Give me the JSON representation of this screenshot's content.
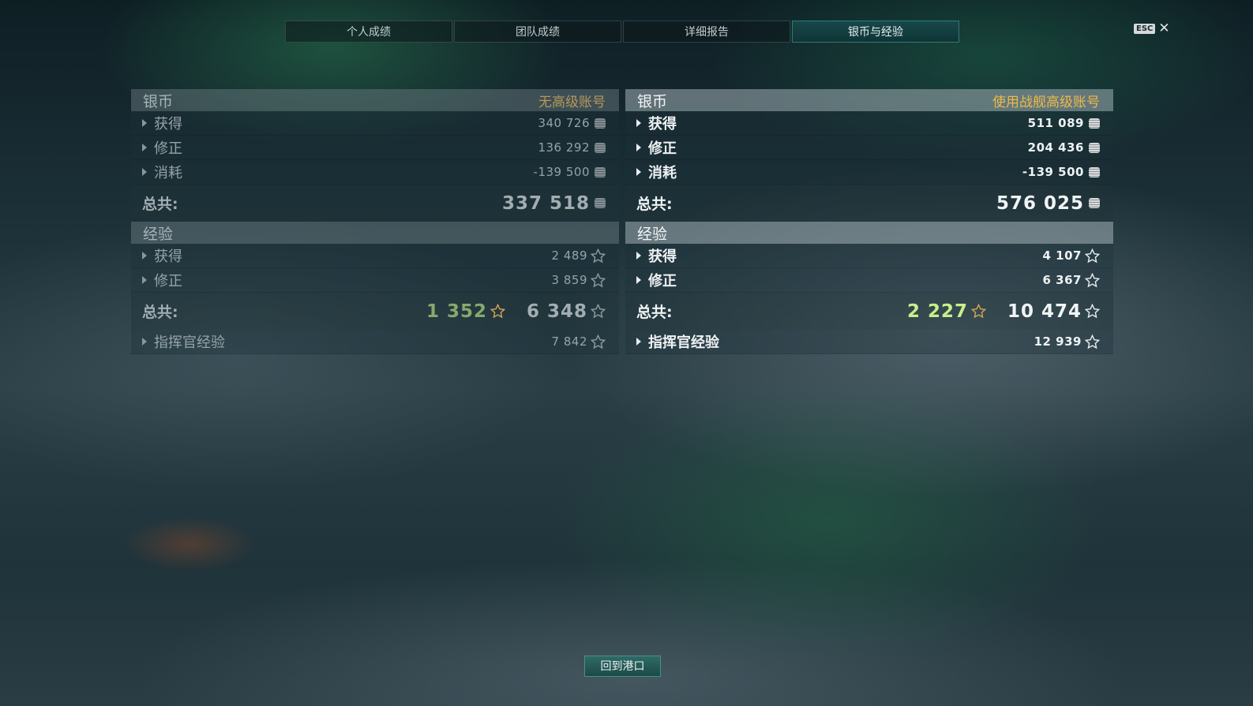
{
  "tabs": [
    {
      "label": "个人成绩",
      "active": false
    },
    {
      "label": "团队成绩",
      "active": false
    },
    {
      "label": "详细报告",
      "active": false
    },
    {
      "label": "银币与经验",
      "active": true
    }
  ],
  "esc": {
    "badge": "ESC",
    "close_icon": "close-icon"
  },
  "left": {
    "credits": {
      "title": "银币",
      "account": "无高级账号",
      "rows": [
        {
          "label": "获得",
          "value": "340 726"
        },
        {
          "label": "修正",
          "value": "136 292"
        },
        {
          "label": "消耗",
          "value": "-139 500"
        }
      ],
      "total_label": "总共:",
      "total_value": "337 518"
    },
    "xp": {
      "title": "经验",
      "rows": [
        {
          "label": "获得",
          "value": "2 489"
        },
        {
          "label": "修正",
          "value": "3 859"
        }
      ],
      "total_label": "总共:",
      "total_base": "1 352",
      "total_value": "6 348",
      "commander_label": "指挥官经验",
      "commander_value": "7 842"
    }
  },
  "right": {
    "credits": {
      "title": "银币",
      "account": "使用战舰高级账号",
      "rows": [
        {
          "label": "获得",
          "value": "511 089"
        },
        {
          "label": "修正",
          "value": "204 436"
        },
        {
          "label": "消耗",
          "value": "-139 500"
        }
      ],
      "total_label": "总共:",
      "total_value": "576 025"
    },
    "xp": {
      "title": "经验",
      "rows": [
        {
          "label": "获得",
          "value": "4 107"
        },
        {
          "label": "修正",
          "value": "6 367"
        }
      ],
      "total_label": "总共:",
      "total_base": "2 227",
      "total_value": "10 474",
      "commander_label": "指挥官经验",
      "commander_value": "12 939"
    }
  },
  "footer": {
    "return_button": "回到港口"
  },
  "colors": {
    "accent_tab": "#18484a",
    "premium_gold": "#f0b84a",
    "base_xp_green": "#c7f08a"
  }
}
